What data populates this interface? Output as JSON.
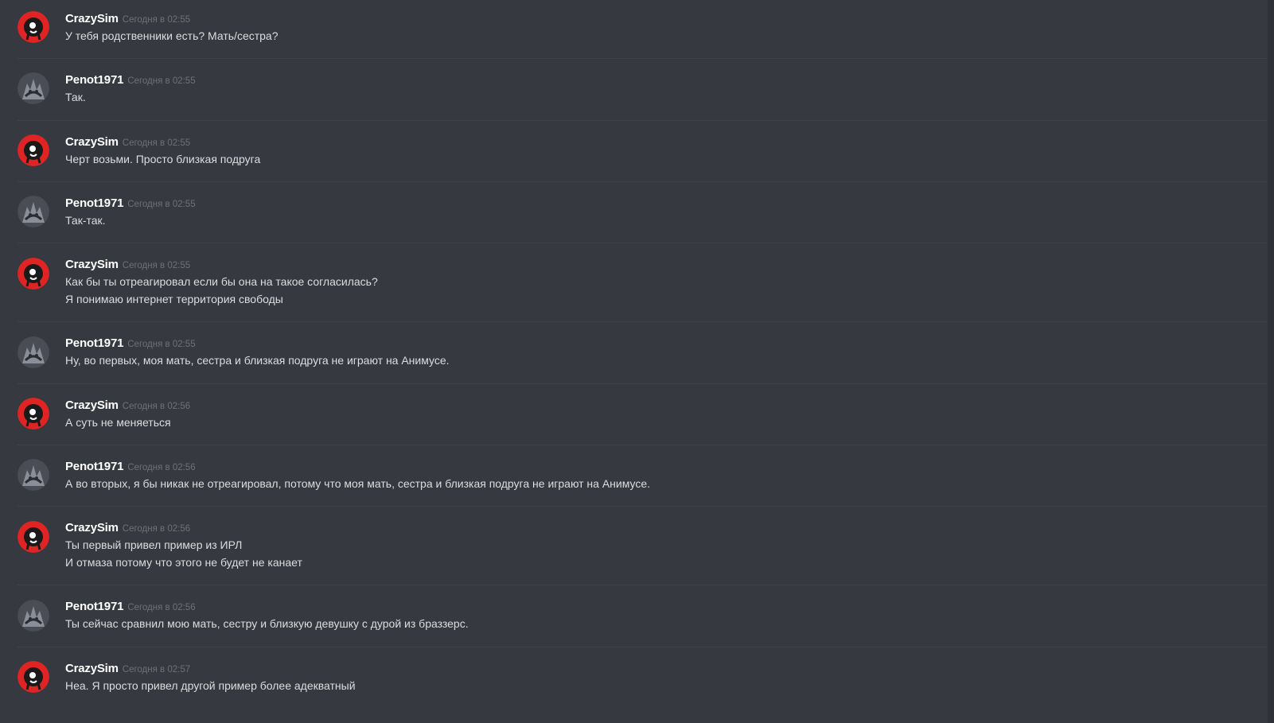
{
  "messages": [
    {
      "author": "CrazySim",
      "avatar": "devil-avatar-icon",
      "timestamp": "Сегодня в 02:55",
      "lines": [
        "У тебя родственники есть? Мать/сестра?"
      ]
    },
    {
      "author": "Penot1971",
      "avatar": "dark-creature-avatar-icon",
      "timestamp": "Сегодня в 02:55",
      "lines": [
        "Так."
      ]
    },
    {
      "author": "CrazySim",
      "avatar": "devil-avatar-icon",
      "timestamp": "Сегодня в 02:55",
      "lines": [
        "Черт возьми. Просто близкая подруга"
      ]
    },
    {
      "author": "Penot1971",
      "avatar": "dark-creature-avatar-icon",
      "timestamp": "Сегодня в 02:55",
      "lines": [
        "Так-так."
      ]
    },
    {
      "author": "CrazySim",
      "avatar": "devil-avatar-icon",
      "timestamp": "Сегодня в 02:55",
      "lines": [
        "Как бы ты отреагировал если бы она на такое согласилась?",
        "Я понимаю интернет территория свободы"
      ]
    },
    {
      "author": "Penot1971",
      "avatar": "dark-creature-avatar-icon",
      "timestamp": "Сегодня в 02:55",
      "lines": [
        "Ну, во первых, моя мать, сестра и близкая подруга не играют на Анимусе."
      ]
    },
    {
      "author": "CrazySim",
      "avatar": "devil-avatar-icon",
      "timestamp": "Сегодня в 02:56",
      "lines": [
        "А суть не меняеться"
      ]
    },
    {
      "author": "Penot1971",
      "avatar": "dark-creature-avatar-icon",
      "timestamp": "Сегодня в 02:56",
      "lines": [
        "А во вторых, я бы никак не отреагировал, потому что моя мать, сестра и близкая подруга не играют на Анимусе."
      ]
    },
    {
      "author": "CrazySim",
      "avatar": "devil-avatar-icon",
      "timestamp": "Сегодня в 02:56",
      "lines": [
        "Ты первый привел пример из ИРЛ",
        "И отмаза потому что этого не будет не канает"
      ]
    },
    {
      "author": "Penot1971",
      "avatar": "dark-creature-avatar-icon",
      "timestamp": "Сегодня в 02:56",
      "lines": [
        "Ты сейчас сравнил мою мать, сестру и близкую девушку с дурой из браззерс."
      ]
    },
    {
      "author": "CrazySim",
      "avatar": "devil-avatar-icon",
      "timestamp": "Сегодня в 02:57",
      "lines": [
        "Неа. Я просто привел другой пример более адекватный"
      ]
    }
  ],
  "colors": {
    "background": "#36393f",
    "author": "#ffffff",
    "timestamp": "#6e7178",
    "message_text": "#dcddde",
    "divider": "#40434a",
    "crazysim_avatar": "#e02424",
    "penot_avatar": "#8a8e99"
  }
}
